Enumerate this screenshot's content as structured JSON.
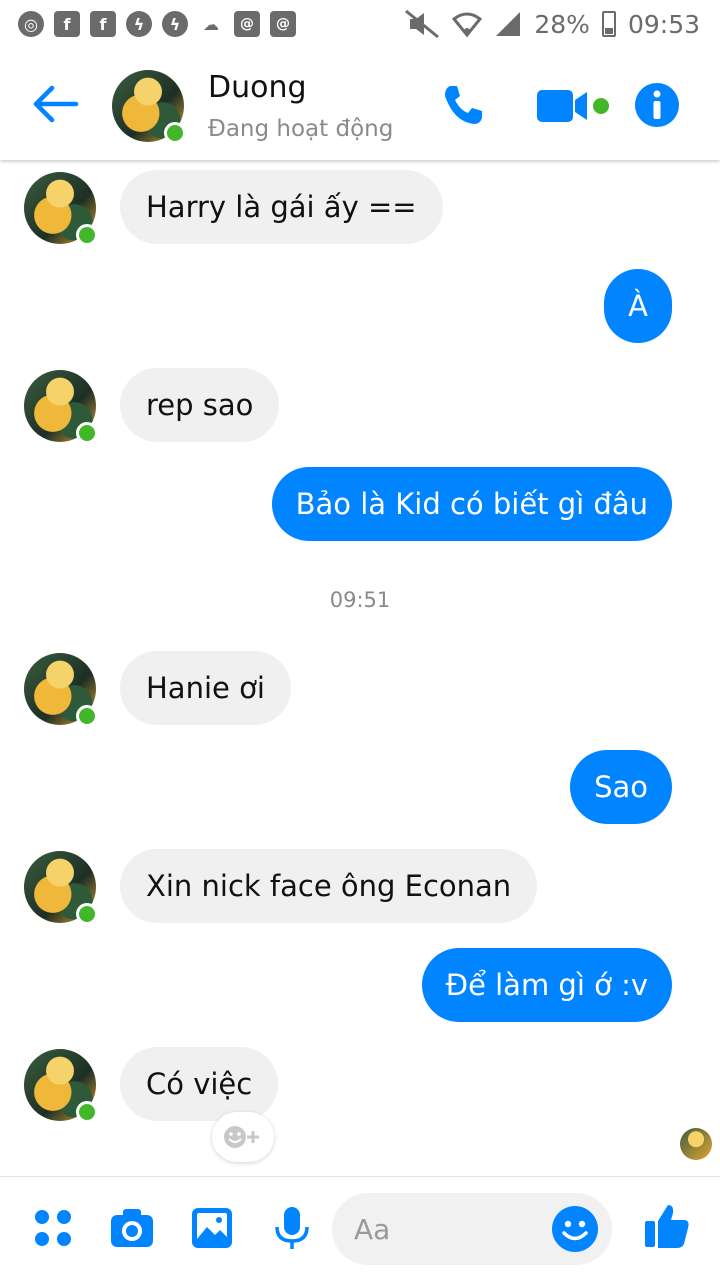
{
  "status_bar": {
    "battery": "28%",
    "time": "09:53",
    "left_icons": [
      "chrome-icon",
      "facebook-icon",
      "facebook-icon",
      "messenger-icon",
      "messenger-icon",
      "weather-icon",
      "email-icon",
      "email-icon"
    ]
  },
  "header": {
    "name": "Duong",
    "status": "Đang hoạt động",
    "accent_color": "#0084ff",
    "online_color": "#42b72a"
  },
  "messages": [
    {
      "side": "in",
      "text": "Harry là gái ấy =="
    },
    {
      "side": "out",
      "text": "À"
    },
    {
      "side": "in",
      "text": "rep sao"
    },
    {
      "side": "out",
      "text": "Bảo là Kid có biết gì đâu"
    },
    {
      "side": "in",
      "text": "Hanie ơi"
    },
    {
      "side": "out",
      "text": "Sao"
    },
    {
      "side": "in",
      "text": "Xin nick face ông Econan"
    },
    {
      "side": "out",
      "text": "Để làm gì ớ :v"
    },
    {
      "side": "in",
      "text": "Có việc"
    }
  ],
  "timestamp": "09:51",
  "composer": {
    "placeholder": "Aa"
  }
}
